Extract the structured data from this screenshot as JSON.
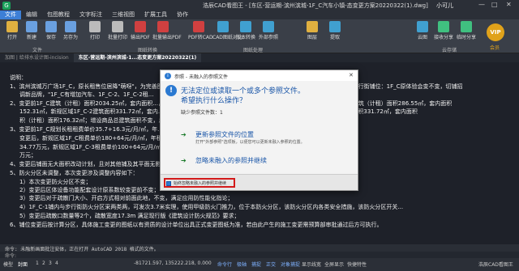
{
  "titlebar": {
    "title": "浩辰CAD看图王 - [东区-营运期-滨州滨城-1F_C汽车小镇-态变更方案20220322(1).dwg]",
    "user": "小可儿",
    "minimize": "—",
    "maximize": "□",
    "close": "✕"
  },
  "menu": [
    {
      "label": "文件",
      "active": true
    },
    {
      "label": "编辑",
      "active": false
    },
    {
      "label": "包图教程",
      "active": false
    },
    {
      "label": "文字标注",
      "active": false
    },
    {
      "label": "三维视图",
      "active": false
    },
    {
      "label": "扩展工具",
      "active": false
    },
    {
      "label": "协作",
      "active": false
    }
  ],
  "ribbon": {
    "tools": [
      {
        "label": "打开",
        "color": "#e0b040"
      },
      {
        "label": "新建",
        "color": "#6aa0e0"
      },
      {
        "label": "保存",
        "color": "#6aa0e0"
      },
      {
        "label": "另存为",
        "color": "#6aa0e0"
      },
      {
        "label": "打印",
        "color": "#bbbbbb"
      },
      {
        "label": "批量打印",
        "color": "#bbbbbb"
      },
      {
        "label": "输出PDF",
        "color": "#d04040"
      },
      {
        "label": "批量输出PDF",
        "color": "#d04040"
      },
      {
        "label": "PDF转CAD",
        "color": "#d04040"
      },
      {
        "label": "CAD图纸对比",
        "color": "#40a0d0"
      },
      {
        "label": "版本转换",
        "color": "#40a0d0"
      },
      {
        "label": "外部参照",
        "color": "#40a0d0"
      },
      {
        "label": "图层",
        "color": "#e0b040"
      },
      {
        "label": "提取",
        "color": "#40a0d0"
      },
      {
        "label": "云图",
        "color": "#40a0d0"
      },
      {
        "label": "接收分享",
        "color": "#40c080"
      },
      {
        "label": "临时分享",
        "color": "#40c080"
      }
    ],
    "groups": [
      "文件",
      "图纸转换",
      "图纸处理",
      "云存储"
    ],
    "vip": "VIP",
    "vip_label": "会员"
  },
  "doctabs": [
    {
      "label": "加图 | 给排水设计图-incision",
      "active": false
    },
    {
      "label": "东区-营运期-滨州滨城-1...态变更方案20220322(1)",
      "active": true
    }
  ],
  "canvas_lines": [
    "说明：",
    "1、滨州滨城万广场1F_C，原长租售位居降\"萌呀\"，为完善图1F_C原，后综合会议室有增设精品推荐方面，增设精品活页，原规划调整为步行街铺位：1F_C原体验会变不变，切铺招",
    "调新品牌，\"1F_C有增加汽车、1F_C-2、1F_C-2租...",
    "2、变更前1F_C建筑（计租）面积2034.25㎡，套内面积...，1F_C-1建筑（计租）面积320.72㎡，套内面积...；变更后新规区域1F_C-1建筑（计租）面积286.55㎡，套内面积",
    "152.31㎡，新规区域1F_C-2建筑面积331.72㎡，套内...，1F_C-3建筑（计租）面积282.55㎡，套内面积...，新规区域1F_C-4建筑面积331.72㎡，套内面积",
    "积（计租）面积176.32㎡；增设商品总建筑面积不变，总...，经济性评估效益增长；",
    "3、变更前1F_C规划长租租费单价35.7+16.3元/月/㎡，年...",
    "变更后，新规区域1F_C租费单价180+64元/月/㎡，年租...，新规区域1F_C-2租费单价100+64元/月/㎡，年租费",
    "34.77万元，新规区域1F_C-3租费单价100+64元/月/㎡，年...，年租费为7651.19万元，较原物营业年租费用差138.78",
    "万元；",
    "4、变更后铺面无大面积改动计划，且对其他铺及其平面无影响；",
    "5、防火分区未调整，本次变更涉及调整内容如下：",
    "1）本次变更防火分区不变；",
    "2）变更后区体设备功能配套设计原系数较变更前不变；",
    "3）变更后对于疏散门大小、开启方式相对前面此地，不变，满足应用防性能化指论；",
    "4）1F_C-1铺内与步行街防火分区采两类两，可发次3.7米实理，使用甲级防火门推力，位于本防火分区，该防火分区内各类安全措施，该防火分区开关...",
    "5）变更后疏散口数量等2个，疏散宽度17.3m 满足现行版《建筑设计防火规范》要求；",
    "6、铺位变更后按计算分区，具体施工变更的图纸以有资质的设计单位出具正式变更图纸为准，若由此产生的施工变更需预算部审批通过后方可执行。"
  ],
  "cmd": {
    "history": "命令: 未融新画面批注安体，正在打开 AutoCAD 2018 格式的文件。",
    "prompt": "命令:"
  },
  "status": {
    "items": [
      {
        "label": "模型",
        "active": false
      },
      {
        "label": "封面",
        "active": true
      },
      {
        "label": "1",
        "active": false
      },
      {
        "label": "2",
        "active": false
      },
      {
        "label": "3",
        "active": false
      },
      {
        "label": "4",
        "active": false
      }
    ],
    "coords": "-81721.597, 135222.218, 0.000",
    "modes": [
      "命令行",
      "极轴",
      "捕捉",
      "正交",
      "对象捕捉",
      "显示线宽",
      "全屏显示",
      "快捷特性"
    ],
    "app": "浩辰CAD看图王"
  },
  "dialog": {
    "title": "参照 - 未融入的参照文件",
    "close": "✕",
    "main_line1": "无法定位或读取一个或多个参照文件。",
    "main_line2": "希望执行什么操作？",
    "sub": "缺少参照文件数：1",
    "option1_title": "更新参照文件的位置",
    "option1_desc": "打开\"外部参照\"选项板，以便您可以更新未融入参照的位置。",
    "option2_title": "忽略未融入的参照并继续",
    "checkbox_label": "始终忽略未融入的参照并继续",
    "info_icon": "i",
    "warn_icon": "!"
  }
}
